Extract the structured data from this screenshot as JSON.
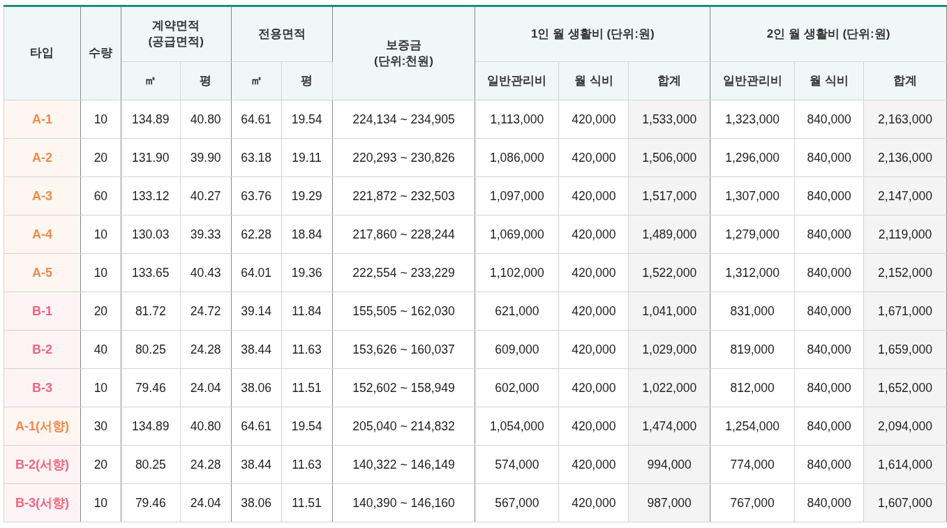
{
  "table": {
    "header_top": [
      {
        "label": "타입",
        "rowspan": 2
      },
      {
        "label": "수량",
        "rowspan": 2
      },
      {
        "label": "계약면적\n(공급면적)",
        "colspan": 2
      },
      {
        "label": "전용면적",
        "colspan": 2
      },
      {
        "label": "보증금\n(단위:천원)",
        "rowspan": 2
      },
      {
        "label": "1인 월 생활비 (단위:원)",
        "colspan": 3
      },
      {
        "label": "2인 월 생활비 (단위:원)",
        "colspan": 3
      }
    ],
    "header_sub": [
      "㎡",
      "평",
      "㎡",
      "평",
      "일반관리비",
      "월 식비",
      "합계",
      "일반관리비",
      "월 식비",
      "합계"
    ],
    "groups": [
      {
        "rows": [
          {
            "type": "A-1",
            "color": "#f08a4b",
            "cells": [
              "10",
              "134.89",
              "40.80",
              "64.61",
              "19.54",
              "224,134 ~ 234,905",
              "1,113,000",
              "420,000",
              "1,533,000",
              "1,323,000",
              "840,000",
              "2,163,000"
            ]
          },
          {
            "type": "A-2",
            "color": "#f08a4b",
            "cells": [
              "20",
              "131.90",
              "39.90",
              "63.18",
              "19.11",
              "220,293 ~ 230,826",
              "1,086,000",
              "420,000",
              "1,506,000",
              "1,296,000",
              "840,000",
              "2,136,000"
            ]
          },
          {
            "type": "A-3",
            "color": "#f08a4b",
            "cells": [
              "60",
              "133.12",
              "40.27",
              "63.76",
              "19.29",
              "221,872 ~ 232,503",
              "1,097,000",
              "420,000",
              "1,517,000",
              "1,307,000",
              "840,000",
              "2,147,000"
            ]
          },
          {
            "type": "A-4",
            "color": "#f08a4b",
            "cells": [
              "10",
              "130.03",
              "39.33",
              "62.28",
              "18.84",
              "217,860 ~ 228,244",
              "1,069,000",
              "420,000",
              "1,489,000",
              "1,279,000",
              "840,000",
              "2,119,000"
            ]
          },
          {
            "type": "A-5",
            "color": "#f08a4b",
            "cells": [
              "10",
              "133.65",
              "40.43",
              "64.01",
              "19.36",
              "222,554 ~ 233,229",
              "1,102,000",
              "420,000",
              "1,522,000",
              "1,312,000",
              "840,000",
              "2,152,000"
            ]
          }
        ]
      },
      {
        "rows": [
          {
            "type": "B-1",
            "color": "#f0667f",
            "cells": [
              "20",
              "81.72",
              "24.72",
              "39.14",
              "11.84",
              "155,505 ~ 162,030",
              "621,000",
              "420,000",
              "1,041,000",
              "831,000",
              "840,000",
              "1,671,000"
            ]
          },
          {
            "type": "B-2",
            "color": "#f0667f",
            "cells": [
              "40",
              "80.25",
              "24.28",
              "38.44",
              "11.63",
              "153,626 ~ 160,037",
              "609,000",
              "420,000",
              "1,029,000",
              "819,000",
              "840,000",
              "1,659,000"
            ]
          },
          {
            "type": "B-3",
            "color": "#f0667f",
            "cells": [
              "10",
              "79.46",
              "24.04",
              "38.06",
              "11.51",
              "152,602 ~ 158,949",
              "602,000",
              "420,000",
              "1,022,000",
              "812,000",
              "840,000",
              "1,652,000"
            ]
          }
        ]
      },
      {
        "rows": [
          {
            "type": "A-1(서향)",
            "color": "#f08a4b",
            "cells": [
              "30",
              "134.89",
              "40.80",
              "64.61",
              "19.54",
              "205,040 ~ 214,832",
              "1,054,000",
              "420,000",
              "1,474,000",
              "1,254,000",
              "840,000",
              "2,094,000"
            ]
          },
          {
            "type": "B-2(서향)",
            "color": "#f0667f",
            "cells": [
              "20",
              "80.25",
              "24.28",
              "38.44",
              "11.63",
              "140,322 ~ 146,149",
              "574,000",
              "420,000",
              "994,000",
              "774,000",
              "840,000",
              "1,614,000"
            ]
          },
          {
            "type": "B-3(서향)",
            "color": "#f0667f",
            "cells": [
              "10",
              "79.46",
              "24.04",
              "38.06",
              "11.51",
              "140,390 ~ 146,160",
              "567,000",
              "420,000",
              "987,000",
              "767,000",
              "840,000",
              "1,607,000"
            ]
          }
        ]
      }
    ]
  }
}
